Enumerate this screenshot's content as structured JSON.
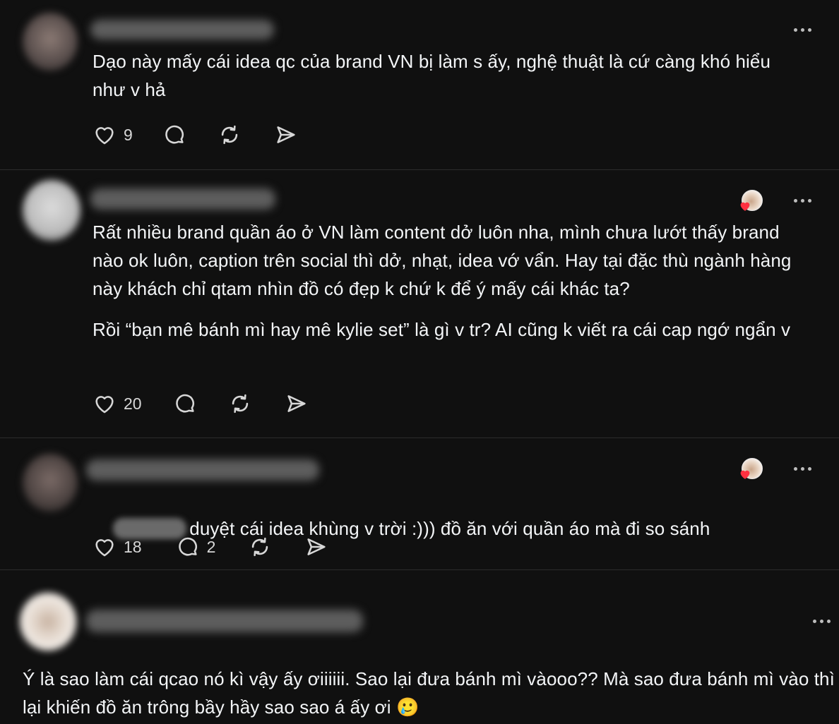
{
  "posts": [
    {
      "text": "Dạo này mấy cái idea qc của brand VN bị làm s ấy, nghệ thuật là cứ càng khó hiểu như v hả",
      "likes": "9",
      "replies": ""
    },
    {
      "text_p1": "Rất nhiều brand quần áo ở VN làm content dở luôn nha, mình chưa lướt thấy brand nào ok luôn, caption trên social thì dở, nhạt, idea vớ vẩn. Hay tại đặc thù ngành hàng này khách chỉ qtam nhìn đồ có đẹp k chứ k để ý mấy cái khác ta?",
      "text_p2": "Rồi “bạn mê bánh mì hay mê kylie set” là gì v tr? AI cũng k viết ra cái cap ngớ ngẩn v",
      "likes": "20",
      "replies": ""
    },
    {
      "text": "duyệt cái idea khùng v trời :))) đồ ăn với quần áo mà đi so sánh",
      "likes": "18",
      "replies": "2"
    },
    {
      "text": "Ý là sao làm cái qcao nó kì vậy ấy ơiiiiii. Sao lại đưa bánh mì vàooo?? Mà sao đưa bánh mì vào thì lại khiến đồ ăn trông bầy hầy sao sao á ấy ơi 🥲"
    }
  ],
  "icons": {
    "like": "heart-icon",
    "reply": "comment-icon",
    "repost": "repost-icon",
    "share": "send-icon",
    "more": "more-icon"
  },
  "colors": {
    "background": "#101010",
    "text": "#f3f5f7",
    "icon": "#d7d7d7",
    "divider": "#2c2c2c",
    "heart_badge": "#ff3040"
  }
}
